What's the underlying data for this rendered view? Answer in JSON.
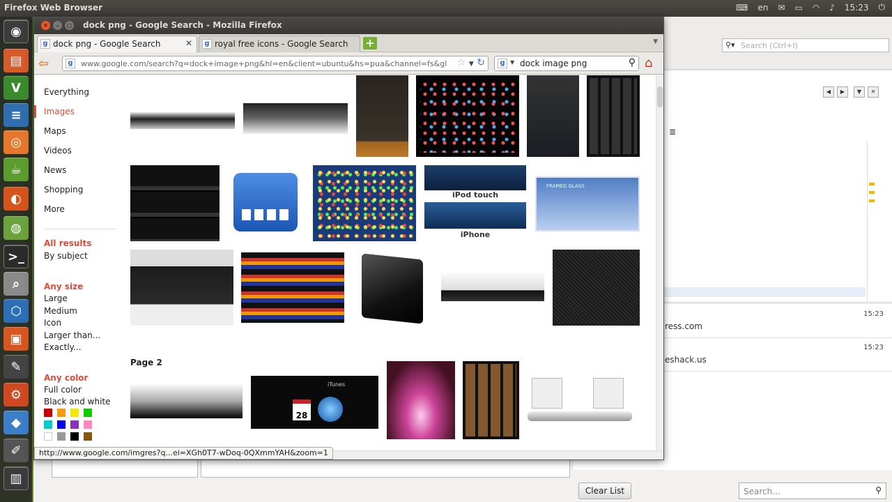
{
  "panel": {
    "app_name": "Firefox Web Browser",
    "keyboard": "en",
    "clock": "15:23"
  },
  "launcher": {
    "items": [
      "dash-home",
      "files",
      "vim",
      "writer",
      "blender",
      "cup",
      "firefox",
      "chromium",
      "terminal",
      "screenshot",
      "virtualbox",
      "package",
      "inkscape",
      "settings",
      "cube",
      "editor",
      "system-monitor"
    ]
  },
  "firefox": {
    "window_title": "dock png - Google Search - Mozilla Firefox",
    "tabs": [
      {
        "label": "dock png - Google Search",
        "active": true
      },
      {
        "label": "royal free icons - Google Search",
        "active": false
      }
    ],
    "new_tab_label": "+",
    "url": "www.google.com/search?q=dock+image+png&hl=en&client=ubuntu&hs=pua&channel=fs&gl",
    "search_value": "dock image png",
    "status_url": "http://www.google.com/imgres?q...ei=XGh0T7-wDoq-0QXmmYAH&zoom=1"
  },
  "google": {
    "nav": [
      "Everything",
      "Images",
      "Maps",
      "Videos",
      "News",
      "Shopping",
      "More"
    ],
    "selected_nav": "Images",
    "results_heading": "All results",
    "results_sub": "By subject",
    "size_heading": "Any size",
    "sizes": [
      "Large",
      "Medium",
      "Icon",
      "Larger than...",
      "Exactly..."
    ],
    "color_heading": "Any color",
    "colors": [
      "Full color",
      "Black and white"
    ],
    "swatches": [
      "#cc0000",
      "#f39c12",
      "#f1e700",
      "#11cc00",
      "#00cccc",
      "#0000ee",
      "#8833bb",
      "#ff88bb",
      "#ffffff",
      "#999999",
      "#000000",
      "#885511"
    ],
    "page2_label": "Page 2",
    "thumb_labels": {
      "ipod": "iPod touch",
      "iphone": "iPhone",
      "framed": "FRAMED GLASS",
      "itunes": "iTunes",
      "cal_day": "28"
    }
  },
  "background_app": {
    "search_placeholder": "Search (Ctrl+I)",
    "downloads": [
      {
        "time": "15:23",
        "url": "ress.com"
      },
      {
        "time": "15:23",
        "url": "eshack.us"
      }
    ],
    "clear_list_label": "Clear List",
    "search2_placeholder": "Search..."
  }
}
